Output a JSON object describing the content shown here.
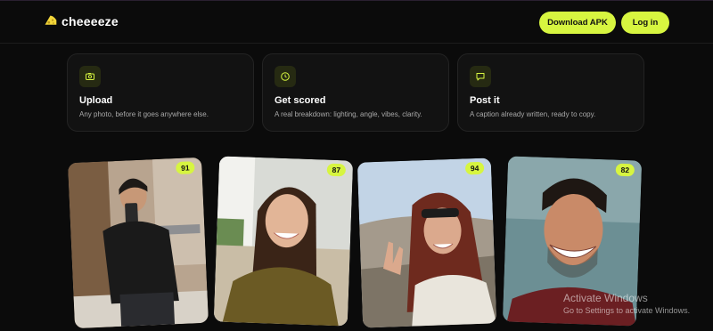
{
  "brand": {
    "name": "cheeeeze",
    "accent": "#d7f540"
  },
  "nav": {
    "download_label": "Download APK",
    "login_label": "Log in"
  },
  "features": [
    {
      "icon": "camera-icon",
      "title": "Upload",
      "desc": "Any photo, before it goes anywhere else."
    },
    {
      "icon": "clock-icon",
      "title": "Get scored",
      "desc": "A real breakdown: lighting, angle, vibes, clarity."
    },
    {
      "icon": "message-icon",
      "title": "Post it",
      "desc": "A caption already written, ready to copy."
    }
  ],
  "photos": [
    {
      "score": "91"
    },
    {
      "score": "87"
    },
    {
      "score": "94"
    },
    {
      "score": "82"
    }
  ],
  "watermark": {
    "line1": "Activate Windows",
    "line2": "Go to Settings to activate Windows."
  }
}
